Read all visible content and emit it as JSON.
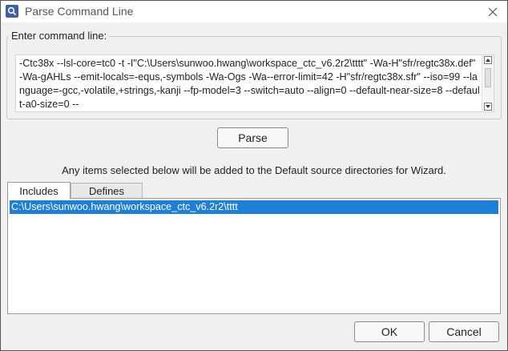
{
  "window": {
    "title": "Parse Command Line"
  },
  "command": {
    "legend": "Enter command line:",
    "value": "-Ctc38x --lsl-core=tc0 -t -I\"C:\\Users\\sunwoo.hwang\\workspace_ctc_v6.2r2\\tttt\" -Wa-H\"sfr/regtc38x.def\" -Wa-gAHLs --emit-locals=-equs,-symbols -Wa-Ogs -Wa--error-limit=42 -H\"sfr/regtc38x.sfr\" --iso=99 --language=-gcc,-volatile,+strings,-kanji --fp-model=3 --switch=auto --align=0 --default-near-size=8 --default-a0-size=0 --"
  },
  "buttons": {
    "parse": "Parse",
    "ok": "OK",
    "cancel": "Cancel"
  },
  "info": "Any items selected below will be added to the Default source directories for Wizard.",
  "tabs": [
    {
      "label": "Includes",
      "active": true
    },
    {
      "label": "Defines",
      "active": false
    }
  ],
  "includes": [
    {
      "path": "C:\\Users\\sunwoo.hwang\\workspace_ctc_v6.2r2\\tttt",
      "selected": true
    }
  ],
  "colors": {
    "selection": "#1e7fd8",
    "app_icon": "#3d5fa8"
  },
  "icons": {
    "app": "search-magnifier-icon",
    "close": "close-icon",
    "scroll_up": "chevron-up-icon",
    "scroll_down": "chevron-down-icon"
  }
}
